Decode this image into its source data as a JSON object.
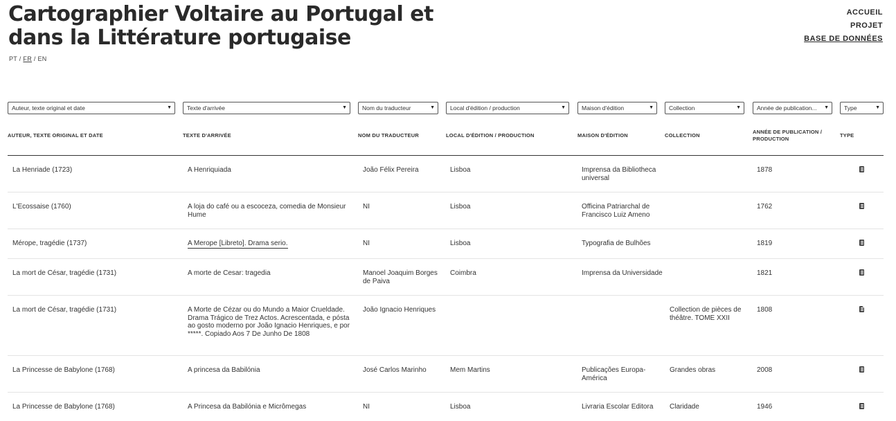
{
  "header": {
    "title": "Cartographier Voltaire au Portugal et dans la Littérature portugaise",
    "languages": [
      "PT",
      "FR",
      "EN"
    ],
    "separator": "/"
  },
  "nav": [
    "ACCUEIL",
    "PROJET",
    "BASE DE DONNÉES"
  ],
  "filters": [
    "Auteur, texte original et date",
    "Texte d'arrivée",
    "Nom du traducteur",
    "Local d'édition / production",
    "Maison d'édition",
    "Collection",
    "Année de publication...",
    "Type"
  ],
  "columns": [
    "AUTEUR, TEXTE ORIGINAL ET DATE",
    "TEXTE D'ARRIVÉE",
    "NOM DU TRADUCTEUR",
    "LOCAL D'ÉDITION / PRODUCTION",
    "MAISON D'ÉDITION",
    "COLLECTION",
    "ANNÉE DE PUBLICATION / PRODUCTION",
    "TYPE"
  ],
  "rows": [
    {
      "author": "La Henriade (1723)",
      "target": "A Henriquiada",
      "translator": "João Félix Pereira",
      "place": "Lisboa",
      "publisher": "Imprensa da Bibliotheca universal",
      "collection": "",
      "year": "1878",
      "type_icon": "document-icon"
    },
    {
      "author": "L'Ecossaise (1760)",
      "target": "A loja do café ou a escoceza, comedia de Monsieur Hume",
      "translator": "NI",
      "place": "Lisboa",
      "publisher": "Officina Patriarchal de Francisco Luiz Ameno",
      "collection": "",
      "year": "1762",
      "type_icon": "document-icon"
    },
    {
      "author": "Mérope, tragédie (1737)",
      "target": "A Merope [Libreto]. Drama serio.",
      "translator": "NI",
      "place": "Lisboa",
      "publisher": "Typografia de Bulhões",
      "collection": "",
      "year": "1819",
      "type_icon": "document-icon"
    },
    {
      "author": "La mort de César, tragédie (1731)",
      "target": "A morte de Cesar: tragedia",
      "translator": "Manoel Joaquim Borges de Paiva",
      "place": "Coimbra",
      "publisher": "Imprensa da Universidade",
      "collection": "",
      "year": "1821",
      "type_icon": "document-icon"
    },
    {
      "author": "La mort de César, tragédie (1731)",
      "target": "A Morte de Cézar ou do Mundo a Maior Crueldade. Drama Trágico de Trez Actos. Acrescentada, e pósta ao gosto moderno por João Ignacio Henriques, e por *****. Copiado Aos 7 De Junho De 1808",
      "translator": "João Ignacio Henriques",
      "place": "",
      "publisher": "",
      "collection": "Collection de pièces de théâtre. TOME XXII",
      "year": "1808",
      "type_icon": "manuscript-icon"
    },
    {
      "author": "La Princesse de Babylone (1768)",
      "target": "A princesa da Babilónia",
      "translator": "José Carlos Marinho",
      "place": "Mem Martins",
      "publisher": "Publicações Europa-América",
      "collection": "Grandes obras",
      "year": "2008",
      "type_icon": "document-icon"
    },
    {
      "author": "La Princesse de Babylone (1768)",
      "target": "A Princesa da Babilónia e Micrômegas",
      "translator": "NI",
      "place": "Lisboa",
      "publisher": "Livraria Escolar Editora",
      "collection": "Claridade",
      "year": "1946",
      "type_icon": "document-icon"
    }
  ]
}
